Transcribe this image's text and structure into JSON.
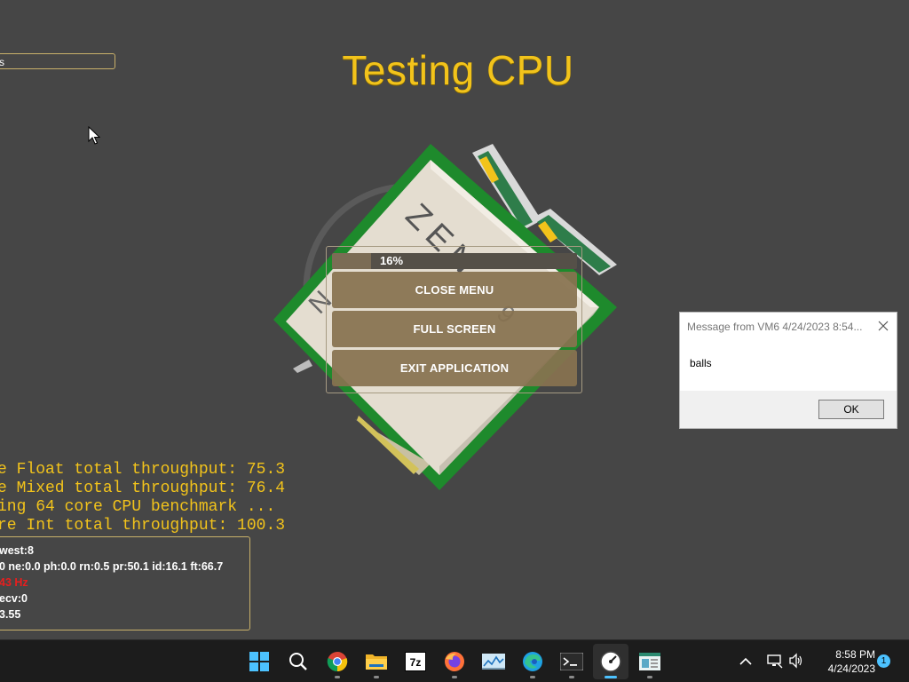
{
  "top_input": {
    "value": "s"
  },
  "title": "Testing CPU",
  "cpu_label": "ZEN",
  "menu": {
    "progress_text": "16%",
    "progress_fraction": 0.16,
    "buttons": [
      "CLOSE MENU",
      "FULL SCREEN",
      "EXIT APPLICATION"
    ]
  },
  "log_lines": [
    "e Float total throughput: 75.3",
    "e Mixed total throughput: 76.4",
    "ing 64 core CPU benchmark ...",
    "re Int total throughput: 100.3"
  ],
  "stats": {
    "line1": "west:8",
    "line2": "0 ne:0.0 ph:0.0 rn:0.5 pr:50.1 id:16.1 ft:66.7",
    "line3": "43 Hz",
    "line4": "ecv:0",
    "line5": "3.55"
  },
  "dialog": {
    "title": "Message from VM6 4/24/2023 8:54...",
    "body": "balls",
    "ok_label": "OK"
  },
  "taskbar": {
    "icons": [
      "windows-start",
      "search",
      "chrome",
      "file-explorer",
      "7zip",
      "firefox",
      "photos",
      "edge",
      "terminal",
      "benchmark-app",
      "notepad-app"
    ],
    "time": "8:58 PM",
    "date": "4/24/2023",
    "notification_count": "1"
  },
  "colors": {
    "background": "#464646",
    "accent_yellow": "#f2c31b",
    "button_brown": "#887250",
    "cpu_green": "#1e8a2c",
    "stats_red": "#e81e1e"
  }
}
